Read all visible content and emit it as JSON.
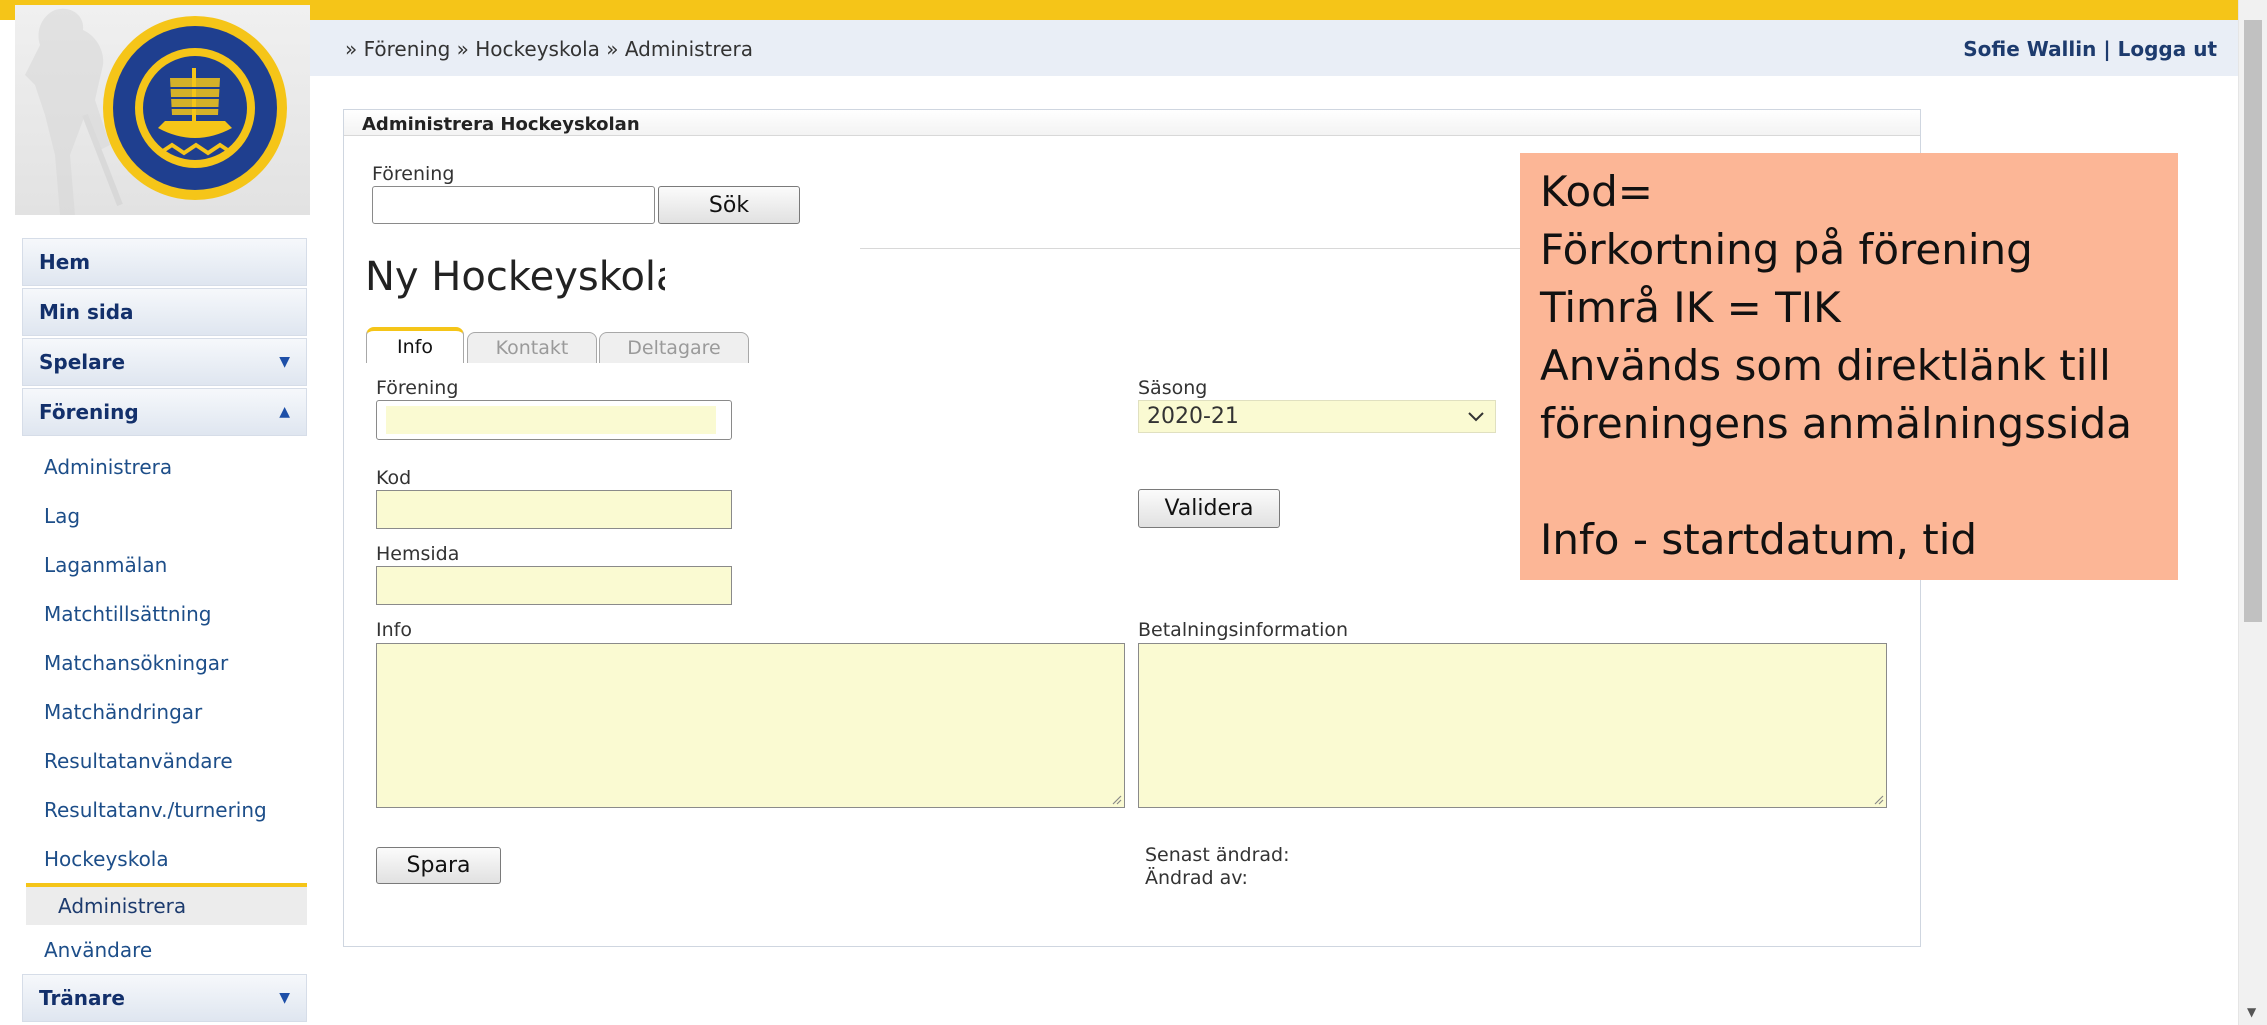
{
  "header": {
    "breadcrumb": "» Förening » Hockeyskola » Administrera",
    "user_name": "Sofie Wallin",
    "separator": "|",
    "logout": "Logga ut"
  },
  "sidebar": {
    "main_items": [
      {
        "label": "Hem"
      },
      {
        "label": "Min sida"
      },
      {
        "label": "Spelare",
        "caret": "▼"
      },
      {
        "label": "Förening",
        "caret": "▲"
      }
    ],
    "sub_items": [
      "Administrera",
      "Lag",
      "Laganmälan",
      "Matchtillsättning",
      "Matchansökningar",
      "Matchändringar",
      "Resultatanvändare",
      "Resultatanv./turnering",
      "Hockeyskola"
    ],
    "active_sub": "Administrera",
    "after_active": "Användare",
    "last_main": {
      "label": "Tränare",
      "caret": "▼"
    }
  },
  "panel": {
    "title": "Administrera Hockeyskolan",
    "search_label": "Förening",
    "search_value": "",
    "search_button": "Sök",
    "heading": "Ny Hockeyskola",
    "tabs": [
      {
        "label": "Info",
        "active": true
      },
      {
        "label": "Kontakt",
        "active": false
      },
      {
        "label": "Deltagare",
        "active": false
      }
    ],
    "form": {
      "forening_label": "Förening",
      "forening_value": "",
      "sasong_label": "Säsong",
      "sasong_value": "2020-21",
      "kod_label": "Kod",
      "kod_value": "",
      "validate_button": "Validera",
      "hemsida_label": "Hemsida",
      "hemsida_value": "",
      "info_label": "Info",
      "info_value": "",
      "betalning_label": "Betalningsinformation",
      "betalning_value": "",
      "save_button": "Spara",
      "last_changed_label": "Senast ändrad:",
      "changed_by_label": "Ändrad av:"
    }
  },
  "annotation": {
    "lines": [
      "Kod=",
      "Förkortning på förening",
      "Timrå IK = TIK",
      "Används som direktlänk till",
      "föreningens anmälningssida",
      "",
      "Info -  startdatum, tid"
    ]
  },
  "colors": {
    "accent": "#f5c518",
    "nav_text": "#13306b",
    "field_bg": "#fafad2",
    "note_bg": "#fcb696"
  }
}
